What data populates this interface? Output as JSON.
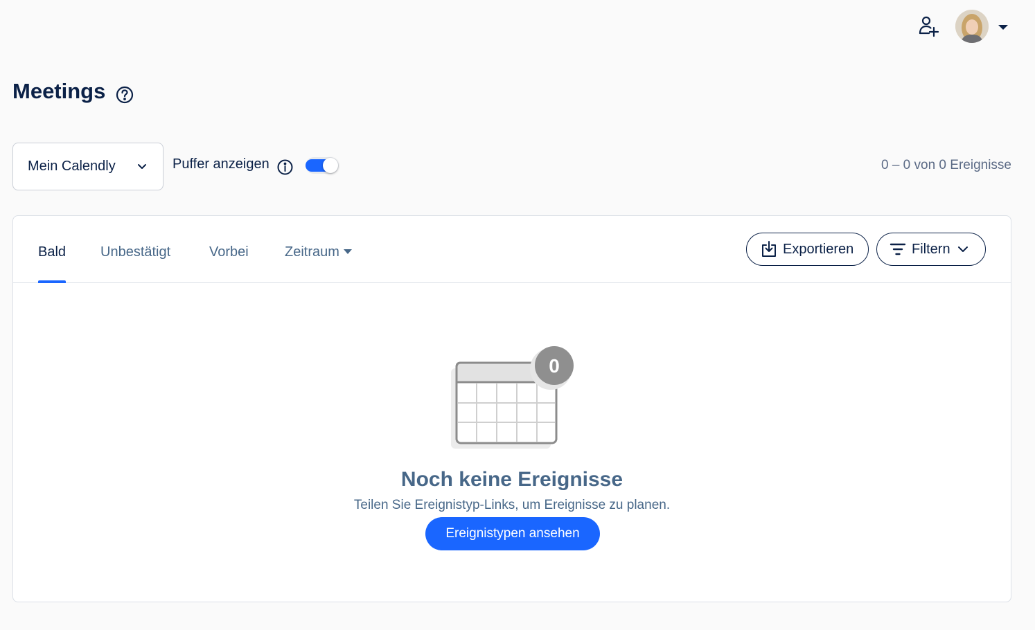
{
  "header": {
    "icons": [
      "add-user-icon",
      "avatar",
      "caret-down-icon"
    ]
  },
  "page": {
    "title": "Meetings"
  },
  "controls": {
    "calendar_select": "Mein Calendly",
    "buffer_label": "Puffer anzeigen",
    "buffer_toggle_on": true,
    "count_text": "0 – 0 von 0 Ereignisse"
  },
  "tabs": [
    {
      "label": "Bald",
      "active": true
    },
    {
      "label": "Unbestätigt",
      "active": false
    },
    {
      "label": "Vorbei",
      "active": false
    },
    {
      "label": "Zeitraum",
      "active": false
    }
  ],
  "actions": {
    "export_label": "Exportieren",
    "filter_label": "Filtern"
  },
  "empty_state": {
    "badge_count": "0",
    "title": "Noch keine Ereignisse",
    "subtitle": "Teilen Sie Ereignistyp-Links, um Ereignisse zu planen.",
    "cta_label": "Ereignistypen ansehen"
  },
  "colors": {
    "accent": "#1a66ff",
    "heading": "#0b2147",
    "muted": "#476788"
  }
}
